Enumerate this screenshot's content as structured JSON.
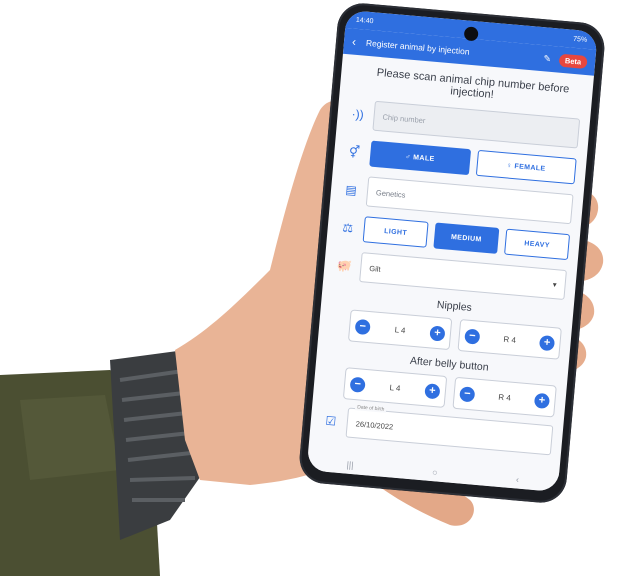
{
  "status": {
    "time": "14:40",
    "battery": "75%"
  },
  "appbar": {
    "title": "Register animal by injection",
    "beta": "Beta"
  },
  "instruction": "Please scan animal chip number before injection!",
  "chip": {
    "placeholder": "Chip number"
  },
  "sex": {
    "male": "MALE",
    "female": "FEMALE",
    "selected": "MALE"
  },
  "genetics": {
    "placeholder": "Genetics"
  },
  "weight": {
    "light": "LIGHT",
    "medium": "MEDIUM",
    "heavy": "HEAVY",
    "selected": "MEDIUM"
  },
  "animal_type": {
    "value": "Gilt"
  },
  "nipples": {
    "label": "Nipples",
    "left": "L 4",
    "right": "R 4"
  },
  "after_belly": {
    "label": "After belly button",
    "left": "L 4",
    "right": "R 4"
  },
  "date_of_birth": {
    "label": "Date of birth",
    "value": "26/10/2022"
  },
  "icons": {
    "back": "arrow-back-icon",
    "edit": "edit-icon",
    "nfc": "nfc-icon",
    "sex": "male-female-icon",
    "genetics": "comment-icon",
    "weight": "weight-icon",
    "animal": "pig-icon",
    "calendar": "calendar-icon"
  },
  "colors": {
    "primary": "#2f6fe0",
    "beta": "#e8473f"
  }
}
